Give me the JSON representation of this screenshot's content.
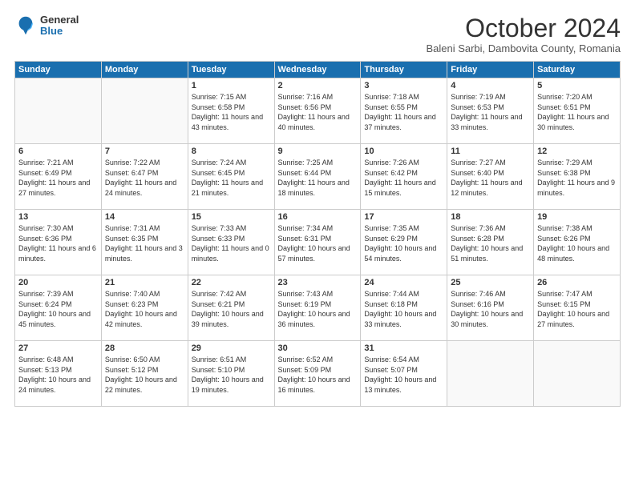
{
  "header": {
    "logo_general": "General",
    "logo_blue": "Blue",
    "month_title": "October 2024",
    "subtitle": "Baleni Sarbi, Dambovita County, Romania"
  },
  "days_of_week": [
    "Sunday",
    "Monday",
    "Tuesday",
    "Wednesday",
    "Thursday",
    "Friday",
    "Saturday"
  ],
  "weeks": [
    [
      {
        "day": "",
        "sunrise": "",
        "sunset": "",
        "daylight": "",
        "empty": true
      },
      {
        "day": "",
        "sunrise": "",
        "sunset": "",
        "daylight": "",
        "empty": true
      },
      {
        "day": "1",
        "sunrise": "Sunrise: 7:15 AM",
        "sunset": "Sunset: 6:58 PM",
        "daylight": "Daylight: 11 hours and 43 minutes."
      },
      {
        "day": "2",
        "sunrise": "Sunrise: 7:16 AM",
        "sunset": "Sunset: 6:56 PM",
        "daylight": "Daylight: 11 hours and 40 minutes."
      },
      {
        "day": "3",
        "sunrise": "Sunrise: 7:18 AM",
        "sunset": "Sunset: 6:55 PM",
        "daylight": "Daylight: 11 hours and 37 minutes."
      },
      {
        "day": "4",
        "sunrise": "Sunrise: 7:19 AM",
        "sunset": "Sunset: 6:53 PM",
        "daylight": "Daylight: 11 hours and 33 minutes."
      },
      {
        "day": "5",
        "sunrise": "Sunrise: 7:20 AM",
        "sunset": "Sunset: 6:51 PM",
        "daylight": "Daylight: 11 hours and 30 minutes."
      }
    ],
    [
      {
        "day": "6",
        "sunrise": "Sunrise: 7:21 AM",
        "sunset": "Sunset: 6:49 PM",
        "daylight": "Daylight: 11 hours and 27 minutes."
      },
      {
        "day": "7",
        "sunrise": "Sunrise: 7:22 AM",
        "sunset": "Sunset: 6:47 PM",
        "daylight": "Daylight: 11 hours and 24 minutes."
      },
      {
        "day": "8",
        "sunrise": "Sunrise: 7:24 AM",
        "sunset": "Sunset: 6:45 PM",
        "daylight": "Daylight: 11 hours and 21 minutes."
      },
      {
        "day": "9",
        "sunrise": "Sunrise: 7:25 AM",
        "sunset": "Sunset: 6:44 PM",
        "daylight": "Daylight: 11 hours and 18 minutes."
      },
      {
        "day": "10",
        "sunrise": "Sunrise: 7:26 AM",
        "sunset": "Sunset: 6:42 PM",
        "daylight": "Daylight: 11 hours and 15 minutes."
      },
      {
        "day": "11",
        "sunrise": "Sunrise: 7:27 AM",
        "sunset": "Sunset: 6:40 PM",
        "daylight": "Daylight: 11 hours and 12 minutes."
      },
      {
        "day": "12",
        "sunrise": "Sunrise: 7:29 AM",
        "sunset": "Sunset: 6:38 PM",
        "daylight": "Daylight: 11 hours and 9 minutes."
      }
    ],
    [
      {
        "day": "13",
        "sunrise": "Sunrise: 7:30 AM",
        "sunset": "Sunset: 6:36 PM",
        "daylight": "Daylight: 11 hours and 6 minutes."
      },
      {
        "day": "14",
        "sunrise": "Sunrise: 7:31 AM",
        "sunset": "Sunset: 6:35 PM",
        "daylight": "Daylight: 11 hours and 3 minutes."
      },
      {
        "day": "15",
        "sunrise": "Sunrise: 7:33 AM",
        "sunset": "Sunset: 6:33 PM",
        "daylight": "Daylight: 11 hours and 0 minutes."
      },
      {
        "day": "16",
        "sunrise": "Sunrise: 7:34 AM",
        "sunset": "Sunset: 6:31 PM",
        "daylight": "Daylight: 10 hours and 57 minutes."
      },
      {
        "day": "17",
        "sunrise": "Sunrise: 7:35 AM",
        "sunset": "Sunset: 6:29 PM",
        "daylight": "Daylight: 10 hours and 54 minutes."
      },
      {
        "day": "18",
        "sunrise": "Sunrise: 7:36 AM",
        "sunset": "Sunset: 6:28 PM",
        "daylight": "Daylight: 10 hours and 51 minutes."
      },
      {
        "day": "19",
        "sunrise": "Sunrise: 7:38 AM",
        "sunset": "Sunset: 6:26 PM",
        "daylight": "Daylight: 10 hours and 48 minutes."
      }
    ],
    [
      {
        "day": "20",
        "sunrise": "Sunrise: 7:39 AM",
        "sunset": "Sunset: 6:24 PM",
        "daylight": "Daylight: 10 hours and 45 minutes."
      },
      {
        "day": "21",
        "sunrise": "Sunrise: 7:40 AM",
        "sunset": "Sunset: 6:23 PM",
        "daylight": "Daylight: 10 hours and 42 minutes."
      },
      {
        "day": "22",
        "sunrise": "Sunrise: 7:42 AM",
        "sunset": "Sunset: 6:21 PM",
        "daylight": "Daylight: 10 hours and 39 minutes."
      },
      {
        "day": "23",
        "sunrise": "Sunrise: 7:43 AM",
        "sunset": "Sunset: 6:19 PM",
        "daylight": "Daylight: 10 hours and 36 minutes."
      },
      {
        "day": "24",
        "sunrise": "Sunrise: 7:44 AM",
        "sunset": "Sunset: 6:18 PM",
        "daylight": "Daylight: 10 hours and 33 minutes."
      },
      {
        "day": "25",
        "sunrise": "Sunrise: 7:46 AM",
        "sunset": "Sunset: 6:16 PM",
        "daylight": "Daylight: 10 hours and 30 minutes."
      },
      {
        "day": "26",
        "sunrise": "Sunrise: 7:47 AM",
        "sunset": "Sunset: 6:15 PM",
        "daylight": "Daylight: 10 hours and 27 minutes."
      }
    ],
    [
      {
        "day": "27",
        "sunrise": "Sunrise: 6:48 AM",
        "sunset": "Sunset: 5:13 PM",
        "daylight": "Daylight: 10 hours and 24 minutes."
      },
      {
        "day": "28",
        "sunrise": "Sunrise: 6:50 AM",
        "sunset": "Sunset: 5:12 PM",
        "daylight": "Daylight: 10 hours and 22 minutes."
      },
      {
        "day": "29",
        "sunrise": "Sunrise: 6:51 AM",
        "sunset": "Sunset: 5:10 PM",
        "daylight": "Daylight: 10 hours and 19 minutes."
      },
      {
        "day": "30",
        "sunrise": "Sunrise: 6:52 AM",
        "sunset": "Sunset: 5:09 PM",
        "daylight": "Daylight: 10 hours and 16 minutes."
      },
      {
        "day": "31",
        "sunrise": "Sunrise: 6:54 AM",
        "sunset": "Sunset: 5:07 PM",
        "daylight": "Daylight: 10 hours and 13 minutes."
      },
      {
        "day": "",
        "sunrise": "",
        "sunset": "",
        "daylight": "",
        "empty": true
      },
      {
        "day": "",
        "sunrise": "",
        "sunset": "",
        "daylight": "",
        "empty": true
      }
    ]
  ]
}
